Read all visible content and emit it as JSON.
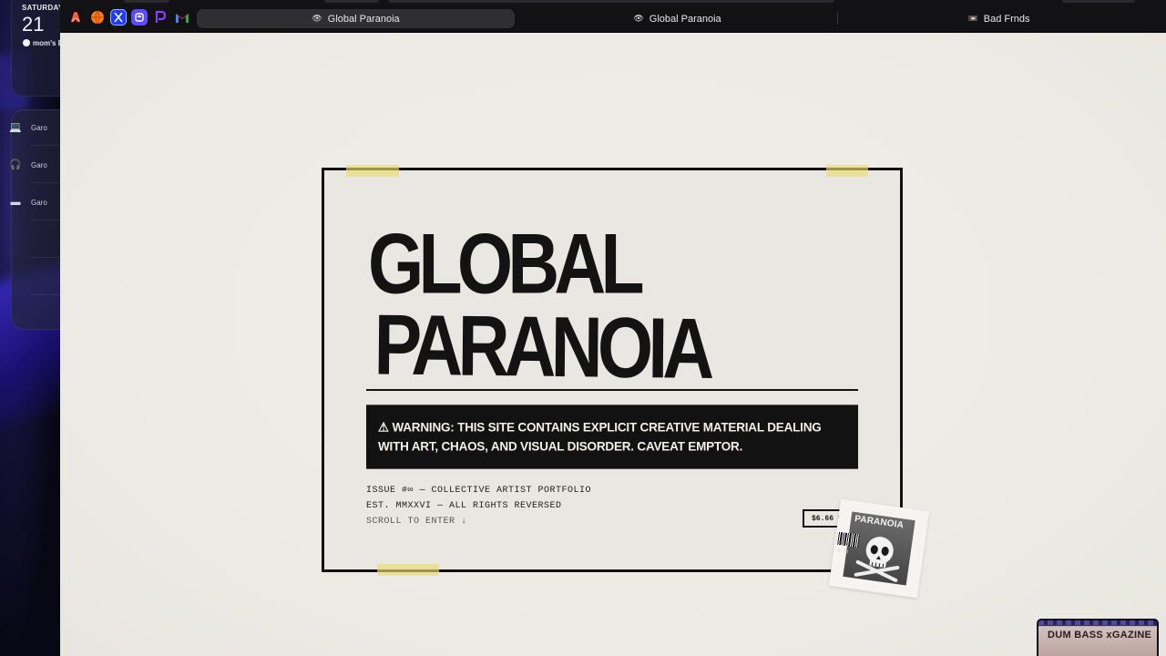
{
  "desktop": {
    "date_widget": {
      "weekday": "SATURDAY",
      "day": "21",
      "event": "mom's B"
    },
    "devices": [
      {
        "icon": "laptop-icon",
        "glyph": "💻",
        "label": "Garo"
      },
      {
        "icon": "earbuds-icon",
        "glyph": "🎧",
        "label": "Garo"
      },
      {
        "icon": "case-icon",
        "glyph": "▬",
        "label": "Garo"
      }
    ]
  },
  "browser": {
    "pinned_favicons": [
      {
        "name": "arc-favicon",
        "glyph": "◆",
        "color": "#ff5b3a"
      },
      {
        "name": "orange-circle-favicon",
        "glyph": "●",
        "color": "#ff7a1a"
      },
      {
        "name": "x-favicon",
        "glyph": "X",
        "color": "#1d3bff"
      },
      {
        "name": "purple-app-favicon",
        "glyph": "◉",
        "color": "#5a4bff"
      },
      {
        "name": "p-favicon",
        "glyph": "P",
        "color": "#8a3cff"
      },
      {
        "name": "gmail-favicon",
        "glyph": "M",
        "color": "#ea4335"
      }
    ],
    "tabs": [
      {
        "label": "Global Paranoia",
        "icon": "👁",
        "active": true
      },
      {
        "label": "Global Paranoia",
        "icon": "👁",
        "active": false
      },
      {
        "label": "Bad Frnds",
        "icon": "📼",
        "active": false
      }
    ]
  },
  "site": {
    "title_line1": "GLOBAL",
    "title_line2": "PARANOIA",
    "warning": "⚠ WARNING: THIS SITE CONTAINS EXPLICIT CREATIVE MATERIAL DEALING WITH ART, CHAOS, AND VISUAL DISORDER. CAVEAT EMPTOR.",
    "issue_line": "ISSUE #∞ — COLLECTIVE ARTIST PORTFOLIO",
    "est_line": "EST. MMXXVI — ALL RIGHTS REVERSED",
    "scroll_line": "SCROLL TO ENTER ↓",
    "price": "$6.66 US",
    "sticker_title": "PARANOIA",
    "sticker_code": "0 74"
  },
  "pip": {
    "label": "DUM BASS xGAZINE"
  },
  "colors": {
    "page_bg": "#ecebe5",
    "ink": "#131313",
    "tape": "#ecdb6e"
  }
}
